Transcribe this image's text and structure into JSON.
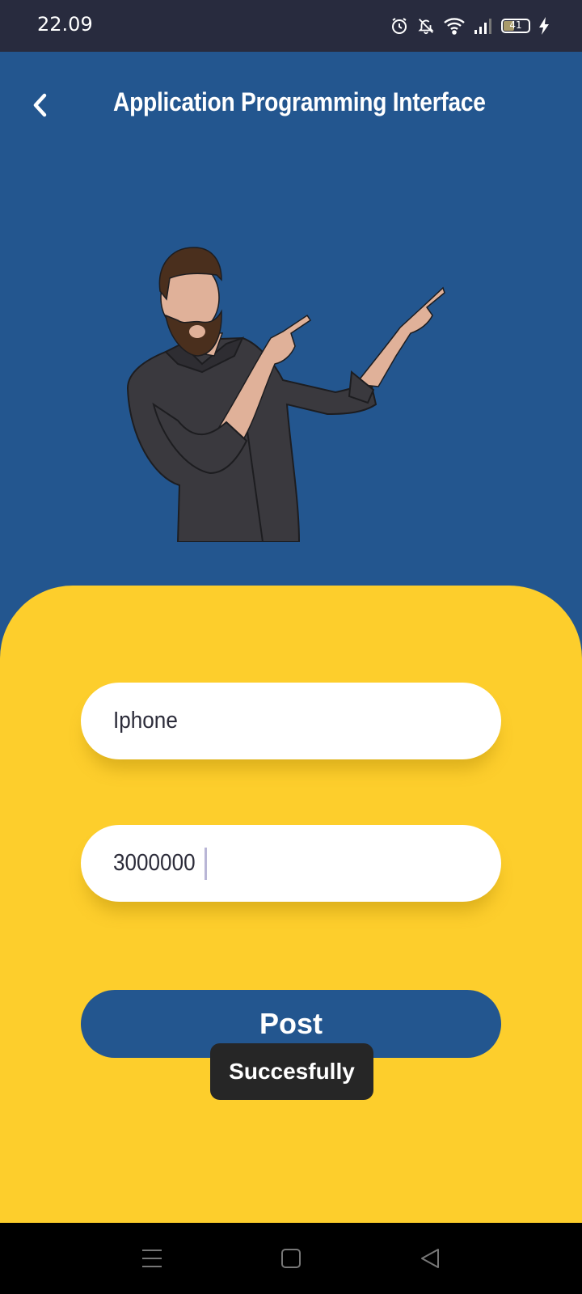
{
  "status_bar": {
    "time": "22.09",
    "battery_level": "41",
    "icons": [
      "alarm-icon",
      "bell-muted-icon",
      "wifi-icon",
      "signal-icon",
      "battery-icon",
      "charging-icon"
    ]
  },
  "app_bar": {
    "title": "Application Programming Interface",
    "back_icon": "chevron-left-icon"
  },
  "form": {
    "name_value": "Iphone",
    "price_value": "3000000",
    "post_label": "Post"
  },
  "toast": {
    "message": "Succesfully"
  },
  "nav_bar": {
    "icons": [
      "menu-icon",
      "home-square-icon",
      "back-triangle-icon"
    ]
  },
  "colors": {
    "primary_blue": "#23568f",
    "accent_yellow": "#fdce2c",
    "status_bar_bg": "#282b3e",
    "toast_bg": "#262626"
  }
}
